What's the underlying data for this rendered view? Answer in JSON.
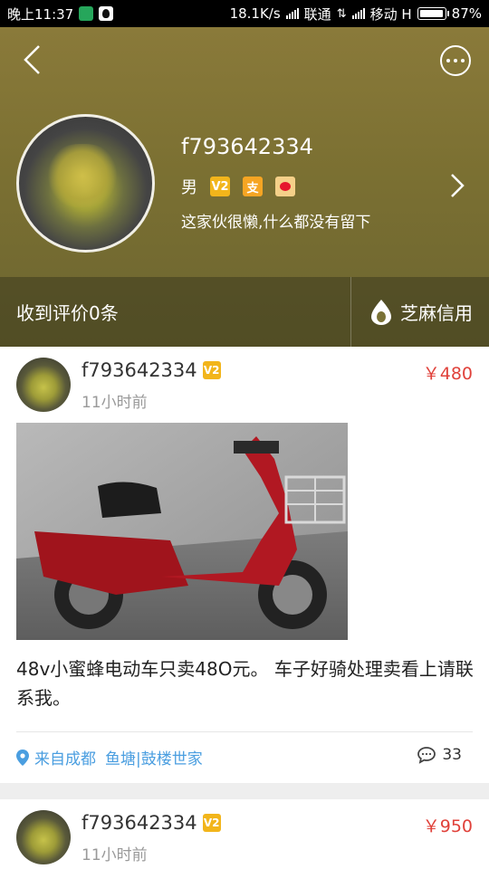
{
  "status_bar": {
    "time": "晚上11:37",
    "speed": "18.1K/s",
    "carrier1": "联通",
    "carrier2": "移动 H",
    "battery": "87%"
  },
  "profile": {
    "username": "f793642334",
    "gender": "男",
    "vip_badge": "V2",
    "zhi_badge": "支",
    "bio": "这家伙很懒,什么都没有留下",
    "reviews": "收到评价0条",
    "credit": "芝麻信用"
  },
  "posts": [
    {
      "username": "f793642334",
      "badge": "V2",
      "time": "11小时前",
      "price": "￥480",
      "description": "48v小蜜蜂电动车只卖48O元。 车子好骑处理卖看上请联系我。",
      "location": "来自成都",
      "tags": "鱼塘|鼓楼世家",
      "comment_count": "33"
    },
    {
      "username": "f793642334",
      "badge": "V2",
      "time": "11小时前",
      "price": "￥950"
    }
  ],
  "colors": {
    "header_bg": "#7b7032",
    "price": "#e0413a",
    "link": "#4a9ee0"
  }
}
